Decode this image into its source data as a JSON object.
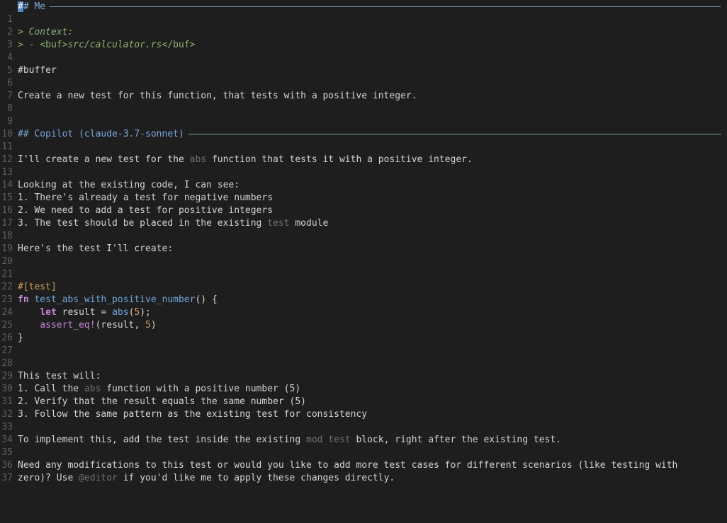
{
  "colors": {
    "background": "#1e1e1e",
    "heading": "#7aa6da",
    "rule_me": "#6ba3c9",
    "rule_copilot": "#5fb3a8",
    "keyword": "#c586d6",
    "function": "#6fa8dc",
    "number": "#d19a66",
    "attribute": "#cfa05a",
    "quote": "#8db270",
    "inline_code": "#707070",
    "line_number": "#5f5f5f"
  },
  "line_numbers": [
    "1",
    "2",
    "3",
    "4",
    "5",
    "6",
    "7",
    "8",
    "9",
    "10",
    "11",
    "12",
    "13",
    "14",
    "15",
    "16",
    "17",
    "18",
    "19",
    "20",
    "21",
    "22",
    "23",
    "24",
    "25",
    "26",
    "27",
    "28",
    "29",
    "30",
    "31",
    "32",
    "33",
    "34",
    "35",
    "36",
    "37",
    ""
  ],
  "me": {
    "heading_cursor": "#",
    "heading_rest": "# Me",
    "context_prefix": "> ",
    "context_label": "Context:",
    "context_item_prefix": "> - ",
    "context_item_tag_open": "<buf>",
    "context_item_path": "src/calculator.rs",
    "context_item_tag_close": "</buf>",
    "buffer_ref": "#buffer",
    "prompt": "Create a new test for this function, that tests with a positive integer."
  },
  "copilot": {
    "heading": "## Copilot (claude-3.7-sonnet)",
    "intro_a": "I'll create a new test for the ",
    "intro_code": "abs",
    "intro_b": " function that tests it with a positive integer.",
    "looking": "Looking at the existing code, I can see:",
    "list1": [
      "1. There's already a test for negative numbers",
      "2. We need to add a test for positive integers"
    ],
    "list1_3a": "3. The test should be placed in the existing ",
    "list1_3code": "test",
    "list1_3b": " module",
    "here": "Here's the test I'll create:",
    "code": {
      "attr": "#[test]",
      "fn_kw": "fn",
      "fn_name": "test_abs_with_positive_number",
      "fn_sig_rest": "() {",
      "let_kw": "let",
      "let_rest_a": " result = ",
      "let_call": "abs",
      "let_paren_open": "(",
      "let_num": "5",
      "let_paren_close": ");",
      "assert_name": "assert_eq!",
      "assert_rest_a": "(result, ",
      "assert_num": "5",
      "assert_rest_b": ")",
      "close": "}"
    },
    "this_test": "This test will:",
    "list2_1a": "1. Call the ",
    "list2_1code": "abs",
    "list2_1b": " function with a positive number (5)",
    "list2_2": "2. Verify that the result equals the same number (5)",
    "list2_3": "3. Follow the same pattern as the existing test for consistency",
    "implement_a": "To implement this, add the test inside the existing ",
    "implement_code": "mod test",
    "implement_b": " block, right after the existing test.",
    "need_line1": "Need any modifications to this test or would you like to add more test cases for different scenarios (like testing with",
    "need_line2a": "zero)? Use ",
    "need_line2code": "@editor",
    "need_line2b": " if you'd like me to apply these changes directly."
  }
}
